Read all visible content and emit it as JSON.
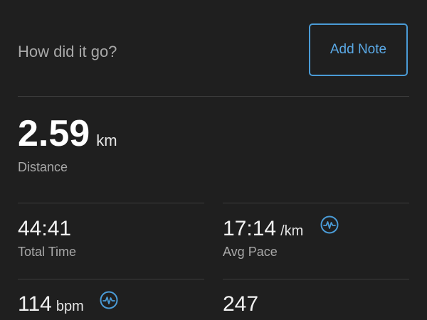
{
  "header": {
    "prompt": "How did it go?",
    "add_note_label": "Add Note"
  },
  "distance": {
    "value": "2.59",
    "unit": "km",
    "label": "Distance"
  },
  "total_time": {
    "value": "44:41",
    "label": "Total Time"
  },
  "avg_pace": {
    "value": "17:14",
    "unit": "/km",
    "label": "Avg Pace",
    "icon": "activity-chart-icon"
  },
  "heart_rate": {
    "value": "114",
    "unit": "bpm",
    "icon": "activity-chart-icon"
  },
  "fourth_stat": {
    "value": "247"
  },
  "colors": {
    "background": "#1f1f1f",
    "accent": "#4a9bd6",
    "label": "#a8a8a8",
    "divider": "#3d3d3d"
  }
}
